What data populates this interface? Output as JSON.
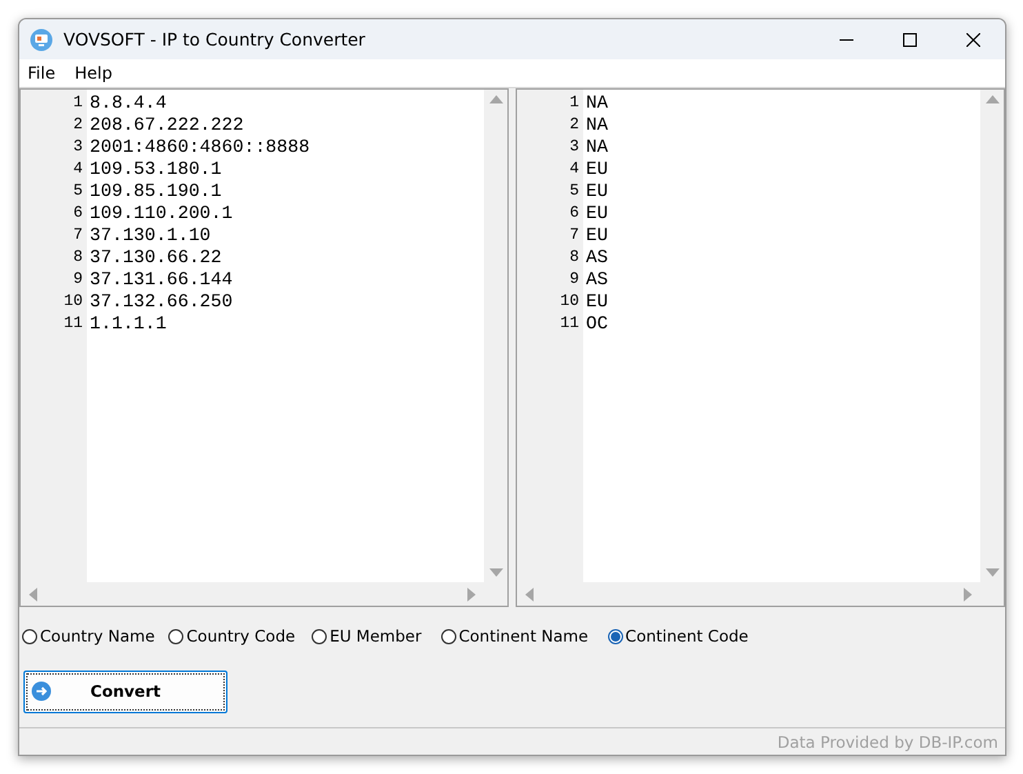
{
  "window": {
    "title": "VOVSOFT - IP to Country Converter"
  },
  "menu": [
    "File",
    "Help"
  ],
  "input_editor": {
    "lines": [
      {
        "number": "1",
        "text": "8.8.4.4"
      },
      {
        "number": "2",
        "text": "208.67.222.222"
      },
      {
        "number": "3",
        "text": "2001:4860:4860::8888"
      },
      {
        "number": "4",
        "text": "109.53.180.1"
      },
      {
        "number": "5",
        "text": "109.85.190.1"
      },
      {
        "number": "6",
        "text": "109.110.200.1"
      },
      {
        "number": "7",
        "text": "37.130.1.10"
      },
      {
        "number": "8",
        "text": "37.130.66.22"
      },
      {
        "number": "9",
        "text": "37.131.66.144"
      },
      {
        "number": "10",
        "text": "37.132.66.250"
      },
      {
        "number": "11",
        "text": "1.1.1.1"
      }
    ]
  },
  "output_editor": {
    "lines": [
      {
        "number": "1",
        "text": "NA"
      },
      {
        "number": "2",
        "text": "NA"
      },
      {
        "number": "3",
        "text": "NA"
      },
      {
        "number": "4",
        "text": "EU"
      },
      {
        "number": "5",
        "text": "EU"
      },
      {
        "number": "6",
        "text": "EU"
      },
      {
        "number": "7",
        "text": "EU"
      },
      {
        "number": "8",
        "text": "AS"
      },
      {
        "number": "9",
        "text": "AS"
      },
      {
        "number": "10",
        "text": "EU"
      },
      {
        "number": "11",
        "text": "OC"
      }
    ]
  },
  "options": [
    {
      "label": "Country Name",
      "selected": false
    },
    {
      "label": "Country Code",
      "selected": false
    },
    {
      "label": "EU Member",
      "selected": false
    },
    {
      "label": "Continent Name",
      "selected": false
    },
    {
      "label": "Continent Code",
      "selected": true
    }
  ],
  "convert_button": {
    "label": "Convert"
  },
  "status_bar": {
    "text": "Data Provided by DB-IP.com"
  }
}
